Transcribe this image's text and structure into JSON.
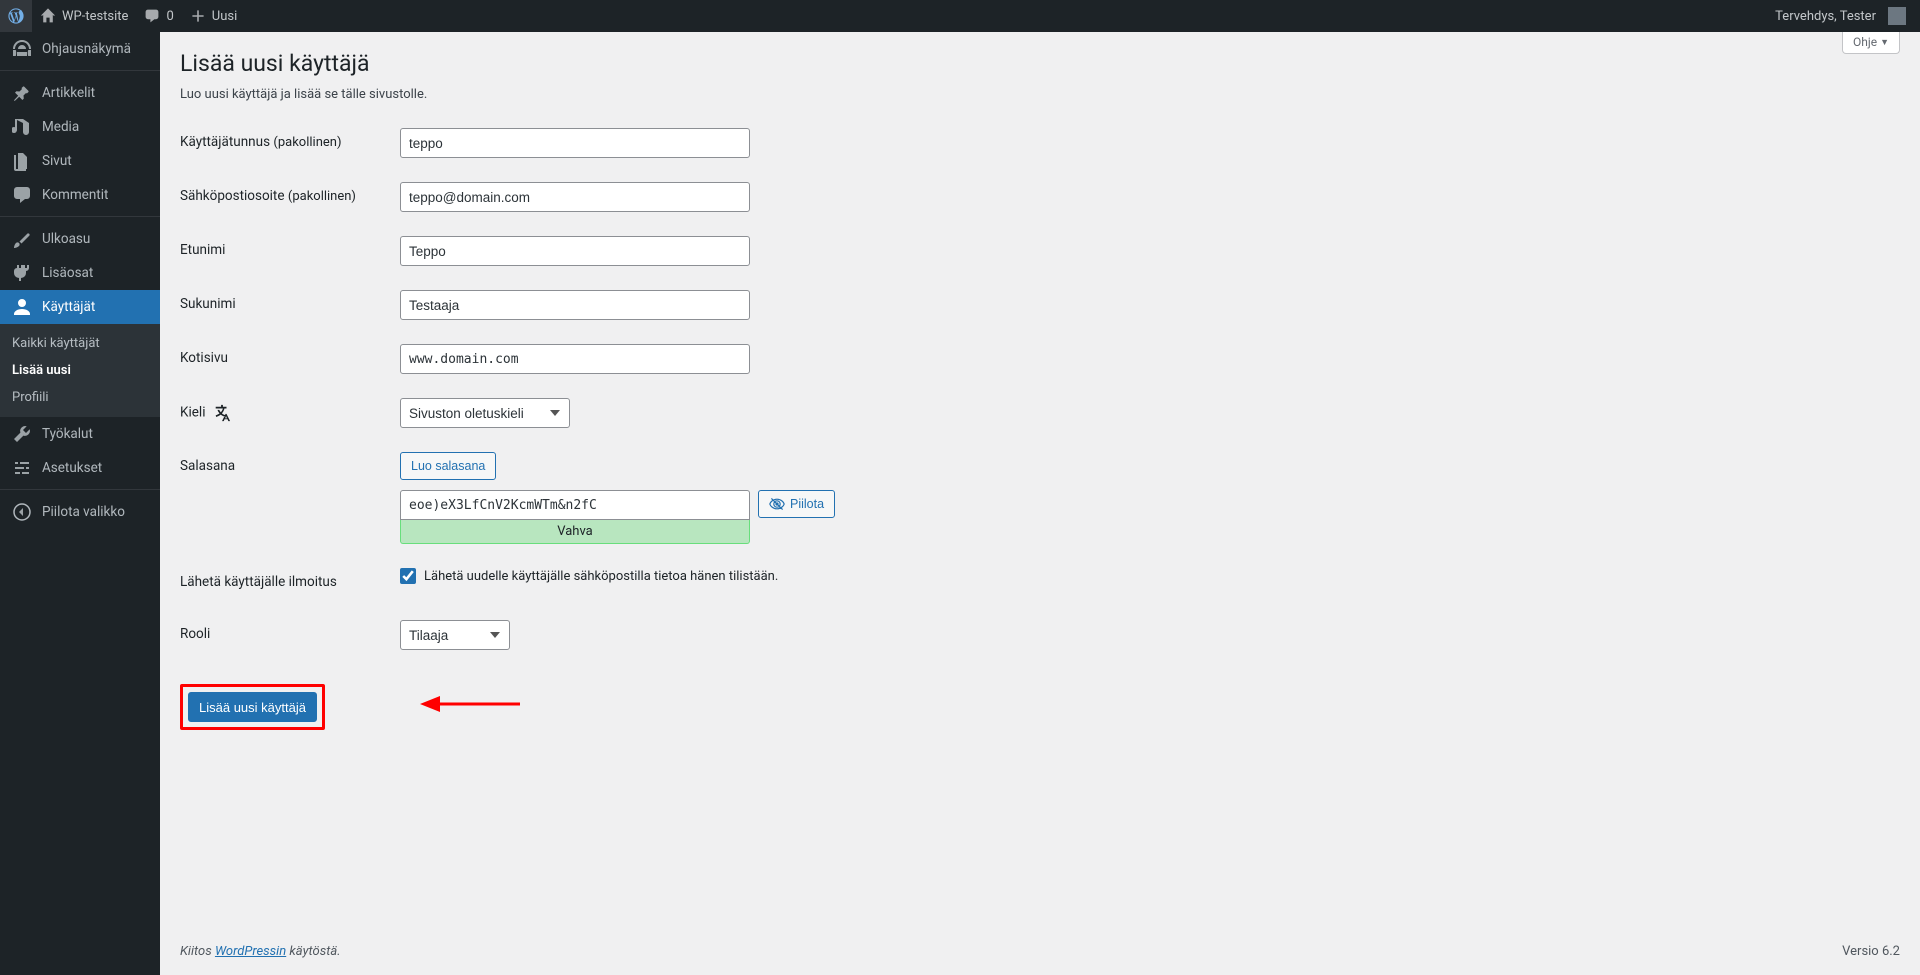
{
  "adminbar": {
    "site_name": "WP-testsite",
    "comments_count": "0",
    "new_label": "Uusi",
    "greeting": "Tervehdys, Tester"
  },
  "sidebar": {
    "items": [
      {
        "label": "Ohjausnäkymä"
      },
      {
        "label": "Artikkelit"
      },
      {
        "label": "Media"
      },
      {
        "label": "Sivut"
      },
      {
        "label": "Kommentit"
      },
      {
        "label": "Ulkoasu"
      },
      {
        "label": "Lisäosat"
      },
      {
        "label": "Käyttäjät"
      },
      {
        "label": "Työkalut"
      },
      {
        "label": "Asetukset"
      },
      {
        "label": "Piilota valikko"
      }
    ],
    "submenu": [
      {
        "label": "Kaikki käyttäjät"
      },
      {
        "label": "Lisää uusi"
      },
      {
        "label": "Profiili"
      }
    ]
  },
  "screen": {
    "help": "Ohje"
  },
  "page": {
    "title": "Lisää uusi käyttäjä",
    "desc": "Luo uusi käyttäjä ja lisää se tälle sivustolle."
  },
  "form": {
    "username_label": "Käyttäjätunnus",
    "required": "(pakollinen)",
    "username_value": "teppo",
    "email_label": "Sähköpostiosoite",
    "email_value": "teppo@domain.com",
    "firstname_label": "Etunimi",
    "firstname_value": "Teppo",
    "lastname_label": "Sukunimi",
    "lastname_value": "Testaaja",
    "website_label": "Kotisivu",
    "website_value": "www.domain.com",
    "language_label": "Kieli",
    "language_value": "Sivuston oletuskieli",
    "password_label": "Salasana",
    "generate_pw": "Luo salasana",
    "password_value": "eoe)eX3LfCnV2KcmWTm&n2fC",
    "hide_pw": "Piilota",
    "pw_strength": "Vahva",
    "notify_label": "Lähetä käyttäjälle ilmoitus",
    "notify_cb": "Lähetä uudelle käyttäjälle sähköpostilla tietoa hänen tilistään.",
    "role_label": "Rooli",
    "role_value": "Tilaaja",
    "submit": "Lisää uusi käyttäjä"
  },
  "footer": {
    "thanks_pre": "Kiitos ",
    "thanks_link": "WordPressin",
    "thanks_post": " käytöstä.",
    "version": "Versio 6.2"
  }
}
